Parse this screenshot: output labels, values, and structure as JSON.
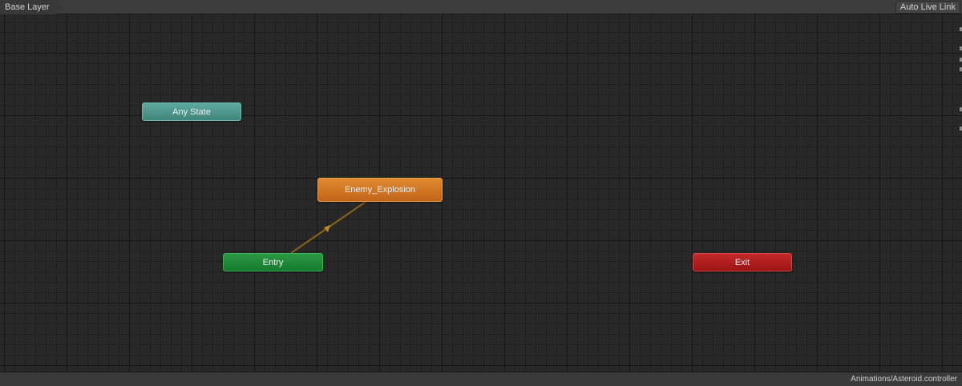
{
  "toolbar": {
    "breadcrumb": "Base Layer",
    "live_link_label": "Auto Live Link"
  },
  "graph": {
    "nodes": {
      "any_state": "Any State",
      "enemy_explosion": "Enemy_Explosion",
      "entry": "Entry",
      "exit": "Exit"
    },
    "colors": {
      "any_state": "#4a978b",
      "default_state": "#d27626",
      "entry": "#208a3a",
      "exit": "#b21e1e",
      "transition": "#8a6418"
    }
  },
  "status": {
    "asset_path": "Animations/Asteroid.controller"
  }
}
